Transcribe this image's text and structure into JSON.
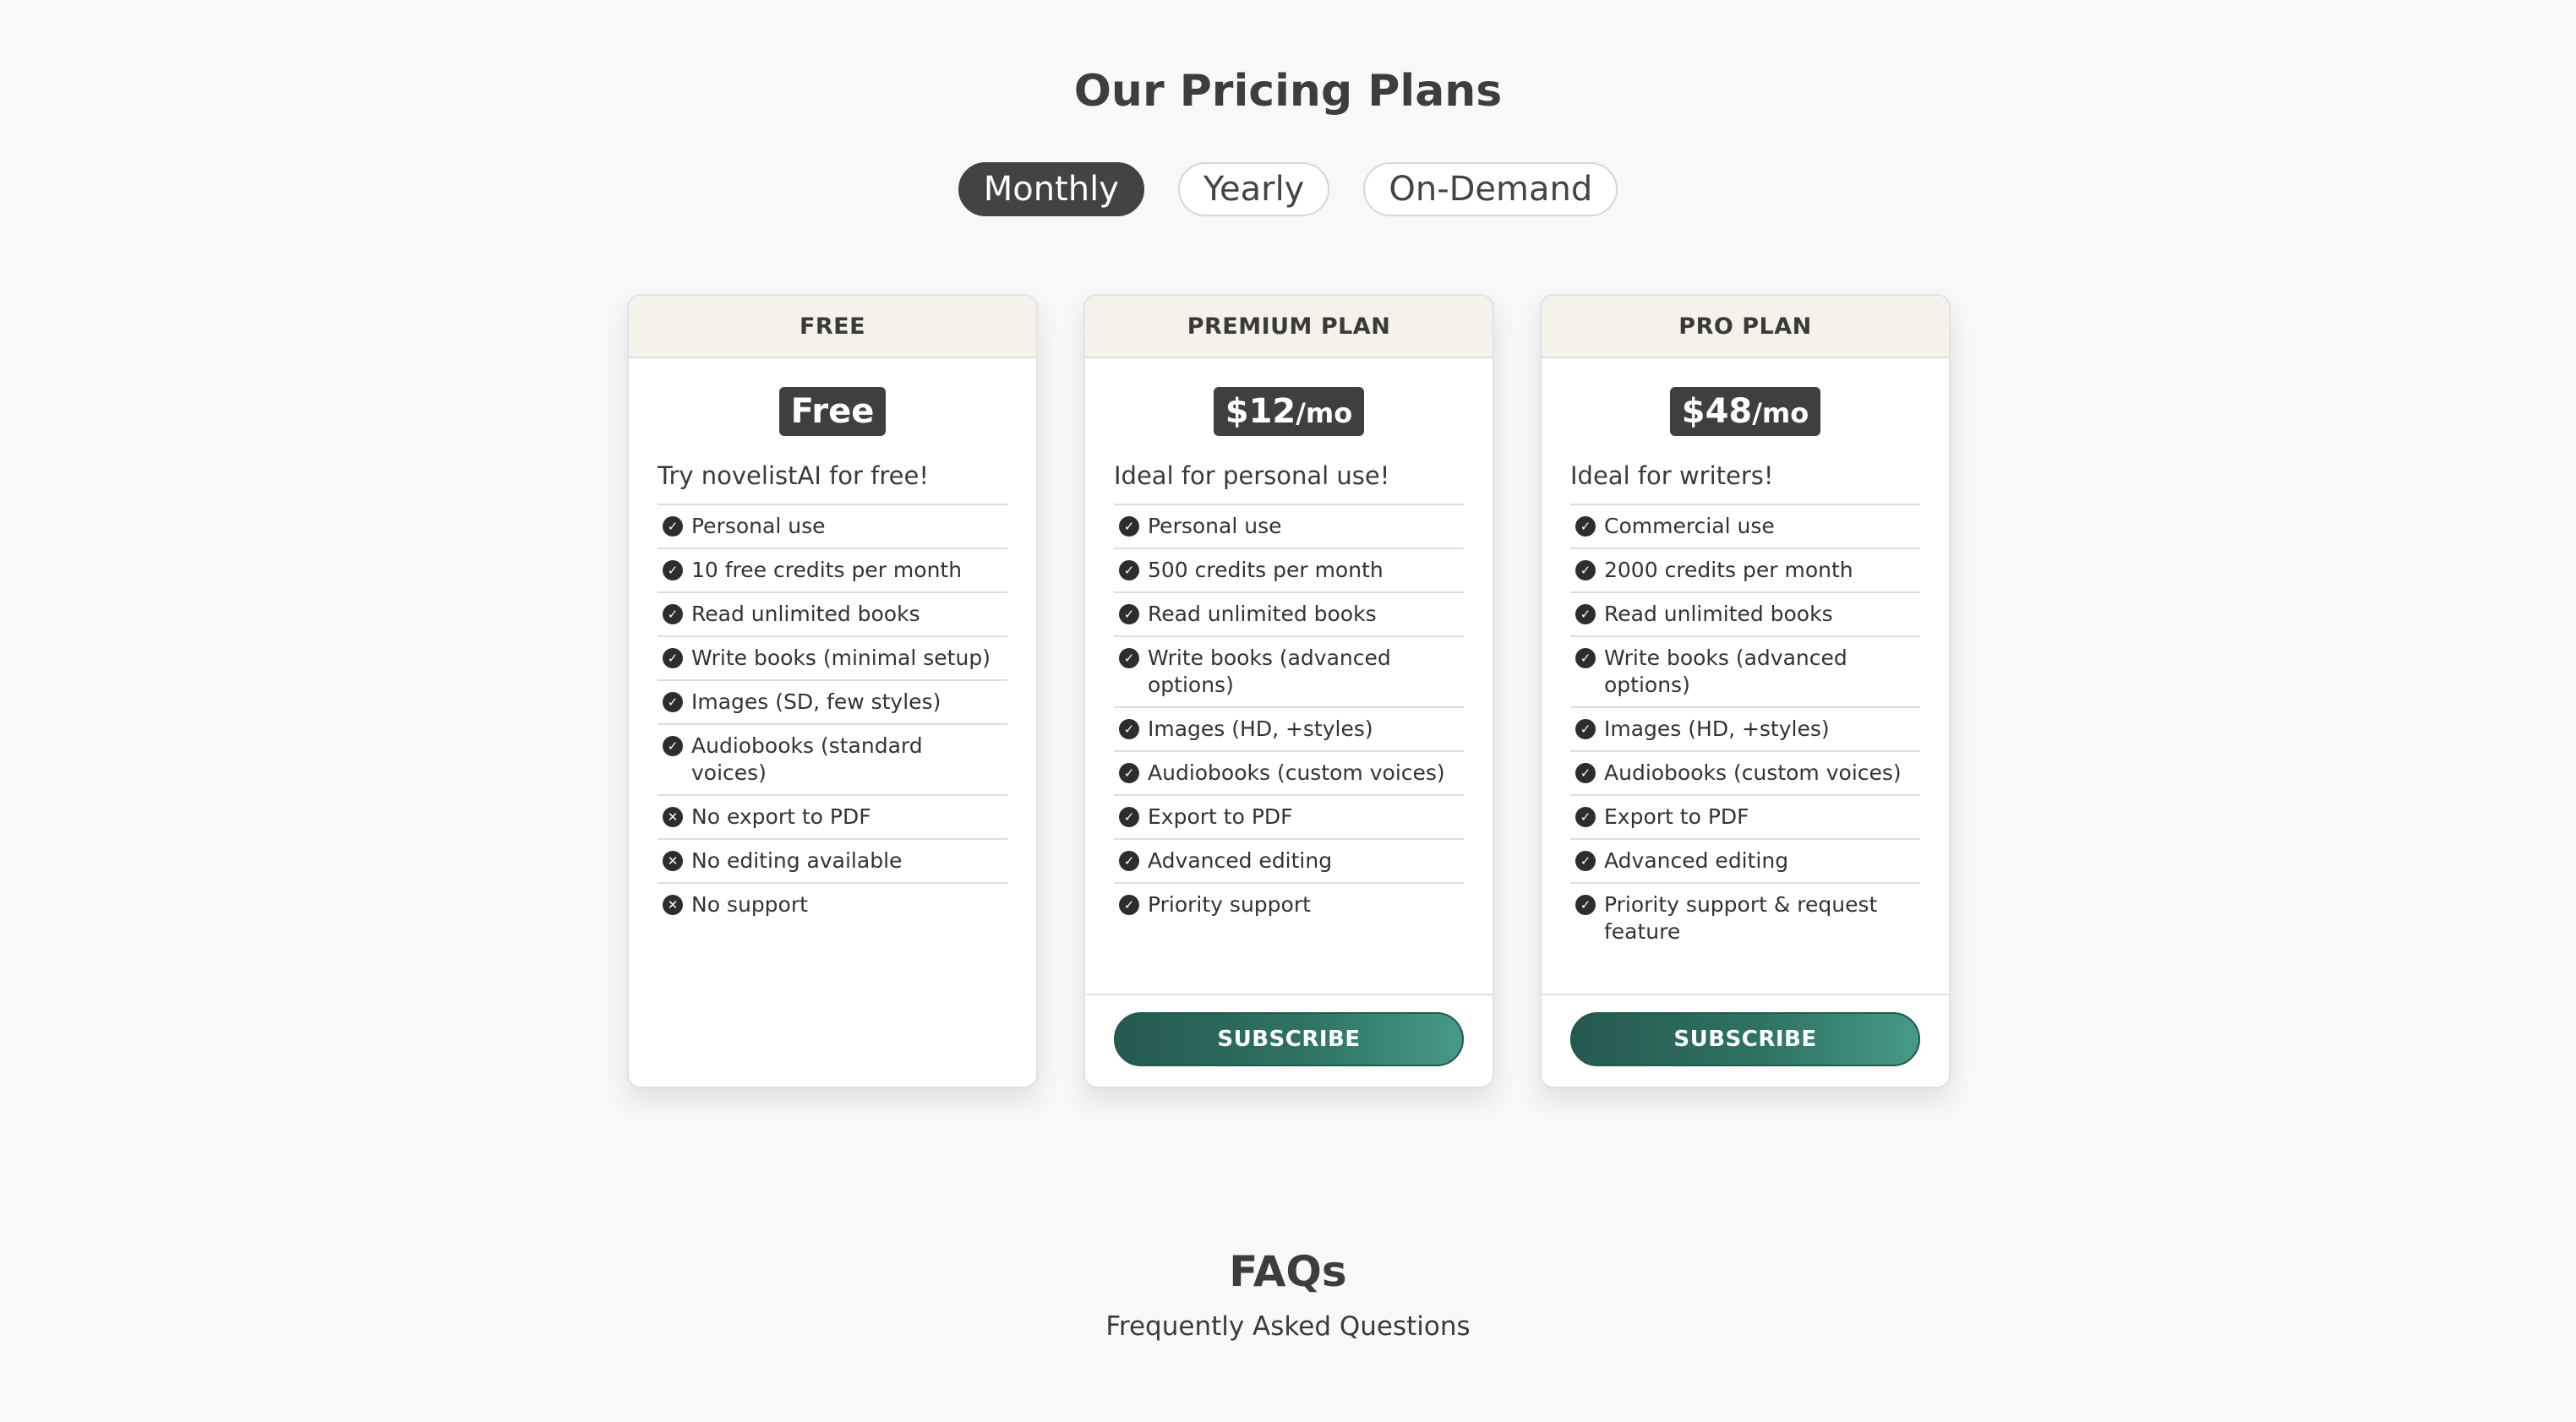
{
  "pricing": {
    "title": "Our Pricing Plans",
    "tabs": [
      {
        "label": "Monthly",
        "active": true
      },
      {
        "label": "Yearly",
        "active": false
      },
      {
        "label": "On-Demand",
        "active": false
      }
    ],
    "plans": [
      {
        "name": "FREE",
        "price": "Free",
        "unit": "",
        "description": "Try novelistAI for free!",
        "features": [
          {
            "text": "Personal use",
            "icon": "check-circle-icon"
          },
          {
            "text": "10 free credits per month",
            "icon": "check-circle-icon"
          },
          {
            "text": "Read unlimited books",
            "icon": "check-circle-icon"
          },
          {
            "text": "Write books (minimal setup)",
            "icon": "check-circle-icon"
          },
          {
            "text": "Images (SD, few styles)",
            "icon": "check-circle-icon"
          },
          {
            "text": "Audiobooks (standard voices)",
            "icon": "check-circle-icon"
          },
          {
            "text": "No export to PDF",
            "icon": "x-circle-icon"
          },
          {
            "text": "No editing available",
            "icon": "x-circle-icon"
          },
          {
            "text": "No support",
            "icon": "x-circle-icon"
          }
        ],
        "button": ""
      },
      {
        "name": "PREMIUM PLAN",
        "price": "$12",
        "unit": "/mo",
        "description": "Ideal for personal use!",
        "features": [
          {
            "text": "Personal use",
            "icon": "check-circle-icon"
          },
          {
            "text": "500 credits per month",
            "icon": "check-circle-icon"
          },
          {
            "text": "Read unlimited books",
            "icon": "check-circle-icon"
          },
          {
            "text": "Write books (advanced options)",
            "icon": "check-circle-icon"
          },
          {
            "text": "Images (HD, +styles)",
            "icon": "check-circle-icon"
          },
          {
            "text": "Audiobooks (custom voices)",
            "icon": "check-circle-icon"
          },
          {
            "text": "Export to PDF",
            "icon": "check-circle-icon"
          },
          {
            "text": "Advanced editing",
            "icon": "check-circle-icon"
          },
          {
            "text": "Priority support",
            "icon": "check-circle-icon"
          }
        ],
        "button": "SUBSCRIBE"
      },
      {
        "name": "PRO PLAN",
        "price": "$48",
        "unit": "/mo",
        "description": "Ideal for writers!",
        "features": [
          {
            "text": "Commercial use",
            "icon": "check-circle-icon"
          },
          {
            "text": "2000 credits per month",
            "icon": "check-circle-icon"
          },
          {
            "text": "Read unlimited books",
            "icon": "check-circle-icon"
          },
          {
            "text": "Write books (advanced options)",
            "icon": "check-circle-icon"
          },
          {
            "text": "Images (HD, +styles)",
            "icon": "check-circle-icon"
          },
          {
            "text": "Audiobooks (custom voices)",
            "icon": "check-circle-icon"
          },
          {
            "text": "Export to PDF",
            "icon": "check-circle-icon"
          },
          {
            "text": "Advanced editing",
            "icon": "check-circle-icon"
          },
          {
            "text": "Priority support & request feature",
            "icon": "check-circle-icon"
          }
        ],
        "button": "SUBSCRIBE"
      }
    ]
  },
  "faq": {
    "title": "FAQs",
    "subtitle": "Frequently Asked Questions"
  },
  "colors": {
    "background": "#f8f8f8",
    "tab_active": "#434343",
    "price_badge": "#3f3f3f",
    "card_header": "#f5f2ec",
    "button_gradient_start": "#25594f",
    "button_gradient_end": "#47998a"
  }
}
